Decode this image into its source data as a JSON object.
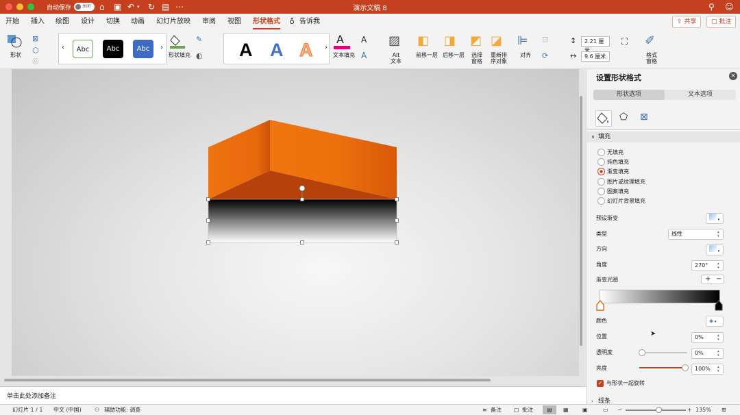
{
  "titlebar": {
    "autosave": "自动保存",
    "toggle": "关闭",
    "title": "演示文稿 8"
  },
  "menu": {
    "tabs": [
      "开始",
      "插入",
      "绘图",
      "设计",
      "切换",
      "动画",
      "幻灯片放映",
      "审阅",
      "视图",
      "形状格式"
    ],
    "active": "形状格式",
    "tell_me": "告诉我",
    "share": "共享",
    "comments": "批注"
  },
  "ribbon": {
    "shape_label": "形状",
    "style_samples": [
      "Abc",
      "Abc",
      "Abc"
    ],
    "shape_fill": "形状填充",
    "text_fill": "文本填充",
    "alt_text": "Alt\n文本",
    "bring_forward": "前移一层",
    "send_backward": "后移一层",
    "selection_pane": "选择\n窗格",
    "reorder": "重新排\n序对象",
    "align": "对齐",
    "height": "2.21 厘米",
    "width": "9.6 厘米",
    "format_pane": "格式\n窗格"
  },
  "notes": {
    "placeholder": "单击此处添加备注"
  },
  "status": {
    "slide": "幻灯片 1 / 1",
    "lang": "中文 (中国)",
    "access": "辅助功能: 调查",
    "notes": "备注",
    "comments": "批注",
    "zoom": "135%",
    "zoom_fraction": 0.55
  },
  "panel": {
    "title": "设置形状格式",
    "tab_shape": "形状选项",
    "tab_text": "文本选项",
    "section_fill": "填充",
    "fill_options": [
      "无填充",
      "纯色填充",
      "渐变填充",
      "图片或纹理填充",
      "图案填充",
      "幻灯片背景填充"
    ],
    "fill_selected": "渐变填充",
    "preset": "预设渐变",
    "type_label": "类型",
    "type_value": "线性",
    "direction": "方向",
    "angle_label": "角度",
    "angle_value": "270°",
    "stops_label": "渐变光圈",
    "color_label": "颜色",
    "position_label": "位置",
    "position_value": "0%",
    "transparency_label": "透明度",
    "transparency_value": "0%",
    "transparency_fraction": 0,
    "brightness_label": "亮度",
    "brightness_value": "100%",
    "brightness_fraction": 1,
    "rotate_with_shape": "与形状一起旋转",
    "section_line": "线条"
  },
  "colors": {
    "accent": "#c5401f",
    "orange_dark": "#b6410a",
    "orange": "#e8690d"
  }
}
